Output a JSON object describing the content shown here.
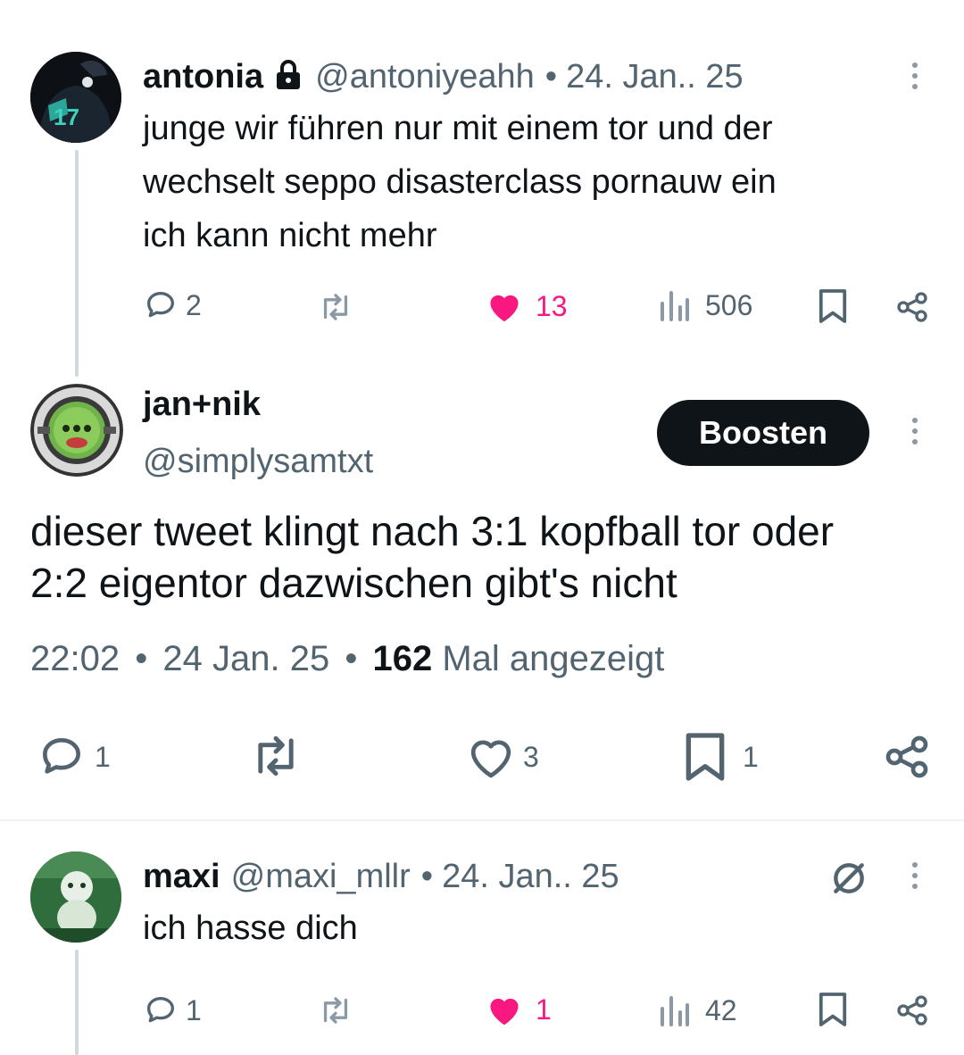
{
  "colors": {
    "text": "#0f1419",
    "muted": "#536471",
    "like": "#f91880",
    "line": "#cfd9de"
  },
  "tweet1": {
    "name": "antonia",
    "lock_icon": "lock-icon",
    "handle": "@antoniyeahh",
    "sep": "•",
    "date": "24. Jan.. 25",
    "lines": [
      "junge wir führen nur mit einem tor und der",
      "wechselt seppo disasterclass pornauw ein",
      "ich kann nicht mehr"
    ],
    "replies": "2",
    "likes": "13",
    "views": "506"
  },
  "main": {
    "name": "jan+nik",
    "handle": "@simplysamtxt",
    "boost_label": "Boosten",
    "lines": [
      "dieser tweet klingt nach 3:1 kopfball tor oder",
      "2:2 eigentor dazwischen gibt's nicht"
    ],
    "time": "22:02",
    "sep": "•",
    "date": "24 Jan. 25",
    "views_count": "162",
    "views_label": "Mal angezeigt",
    "replies": "1",
    "likes": "3",
    "bookmarks": "1"
  },
  "tweet3": {
    "name": "maxi",
    "handle": "@maxi_mllr",
    "sep": "•",
    "date": "24. Jan.. 25",
    "text": "ich hasse dich",
    "replies": "1",
    "likes": "1",
    "views": "42"
  }
}
